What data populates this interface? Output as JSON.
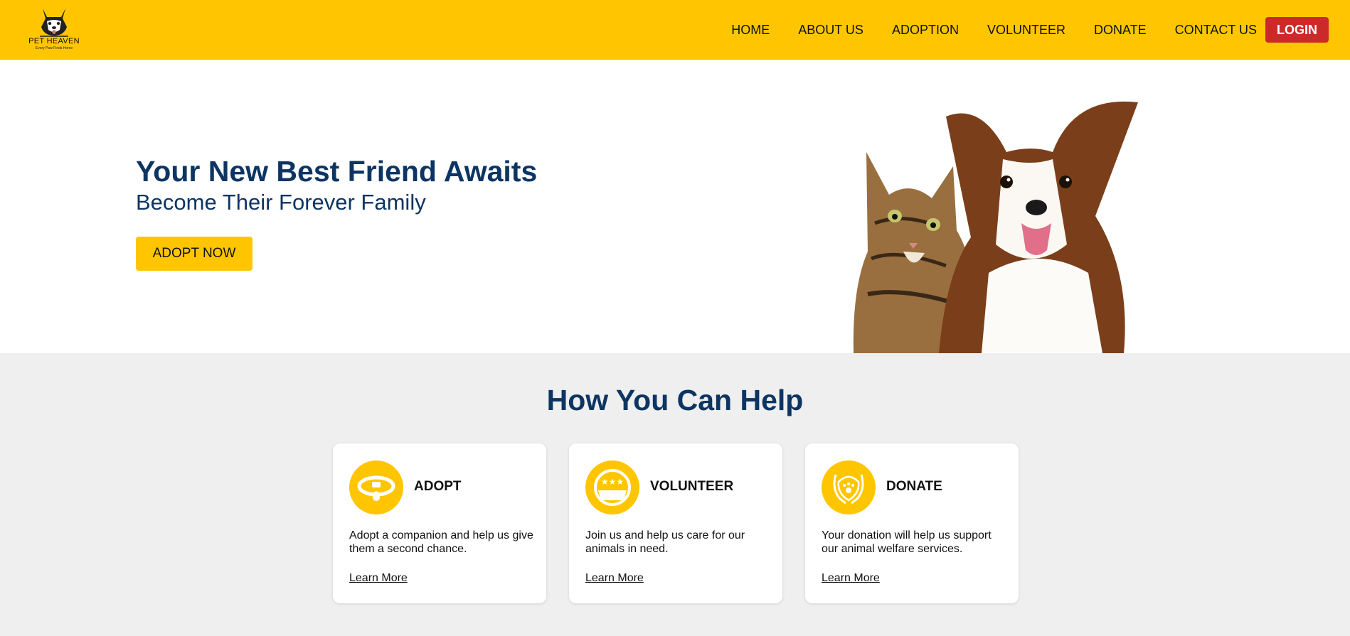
{
  "brand": {
    "name": "PET HEAVEN",
    "tagline": "Every Paw Finds Home",
    "accent_color": "#ffc600",
    "login_color": "#cc2a2a",
    "heading_color": "#0d3563"
  },
  "nav": {
    "items": [
      "HOME",
      "ABOUT US",
      "ADOPTION",
      "VOLUNTEER",
      "DONATE",
      "CONTACT US"
    ],
    "login": "LOGIN"
  },
  "hero": {
    "title": "Your New Best Friend Awaits",
    "subtitle": "Become Their Forever Family",
    "cta": "ADOPT NOW",
    "image": "cat-and-dog-photo"
  },
  "help": {
    "title": "How You Can Help",
    "cards": [
      {
        "icon": "collar-icon",
        "title": "ADOPT",
        "desc": "Adopt a companion and help us give them a second chance.",
        "link": "Learn More"
      },
      {
        "icon": "volunteer-basket-icon",
        "title": "VOLUNTEER",
        "desc": "Join us and help us care for our animals in need.",
        "link": "Learn More"
      },
      {
        "icon": "donate-hands-paw-icon",
        "title": "DONATE",
        "desc": "Your donation will help us support our animal welfare services.",
        "link": "Learn More"
      }
    ]
  }
}
